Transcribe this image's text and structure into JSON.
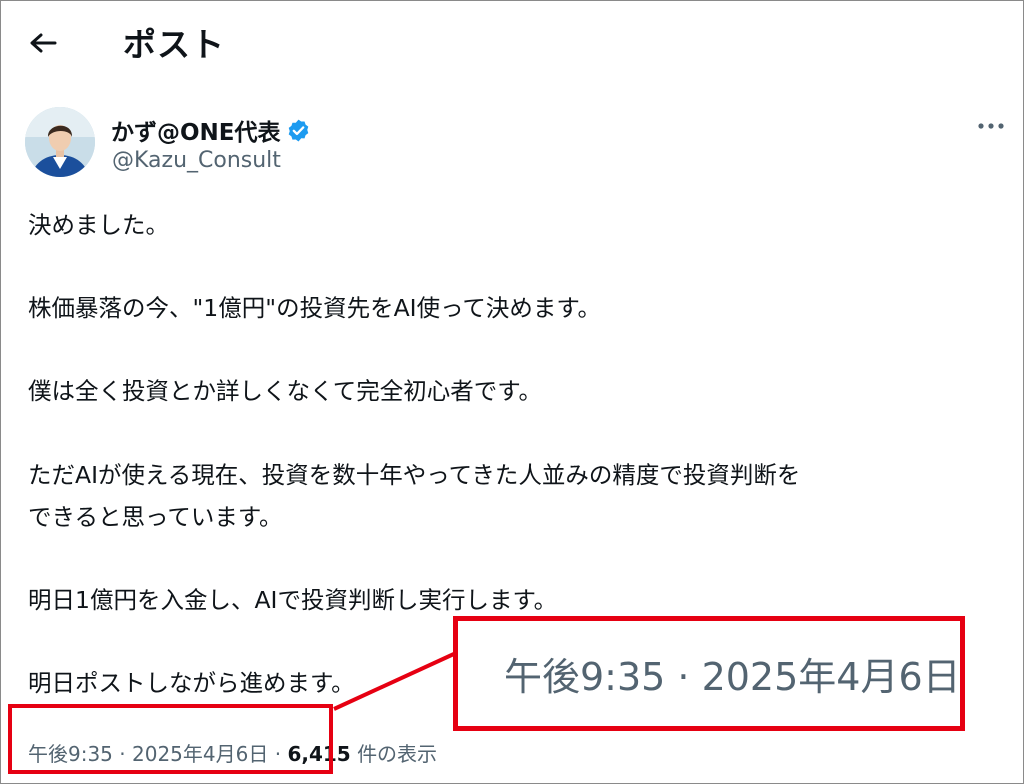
{
  "header": {
    "title": "ポスト",
    "back_icon": "arrow-left-icon"
  },
  "author": {
    "display_name": "かず@ONE代表",
    "handle": "@Kazu_Consult",
    "verified_icon": "verified-badge-icon",
    "verified_color": "#1d9bf0"
  },
  "post": {
    "lines": [
      "決めました。",
      "株価暴落の今、\"1億円\"の投資先をAI使って決めます。",
      "僕は全く投資とか詳しくなくて完全初心者です。",
      "ただAIが使える現在、投資を数十年やってきた人並みの精度で投資判断を",
      "できると思っています。",
      "明日1億円を入金し、AIで投資判断し実行します。",
      "明日ポストしながら進めます。"
    ]
  },
  "meta": {
    "time": "午後9:35",
    "separator": "·",
    "date": "2025年4月6日",
    "views_count": "6,415",
    "views_label": "件の表示"
  },
  "annotation": {
    "zoom_text": "午後9:35 · 2025年4月6日 ·",
    "highlight_color": "#e60012"
  },
  "colors": {
    "text_primary": "#0f1419",
    "text_secondary": "#536471"
  }
}
